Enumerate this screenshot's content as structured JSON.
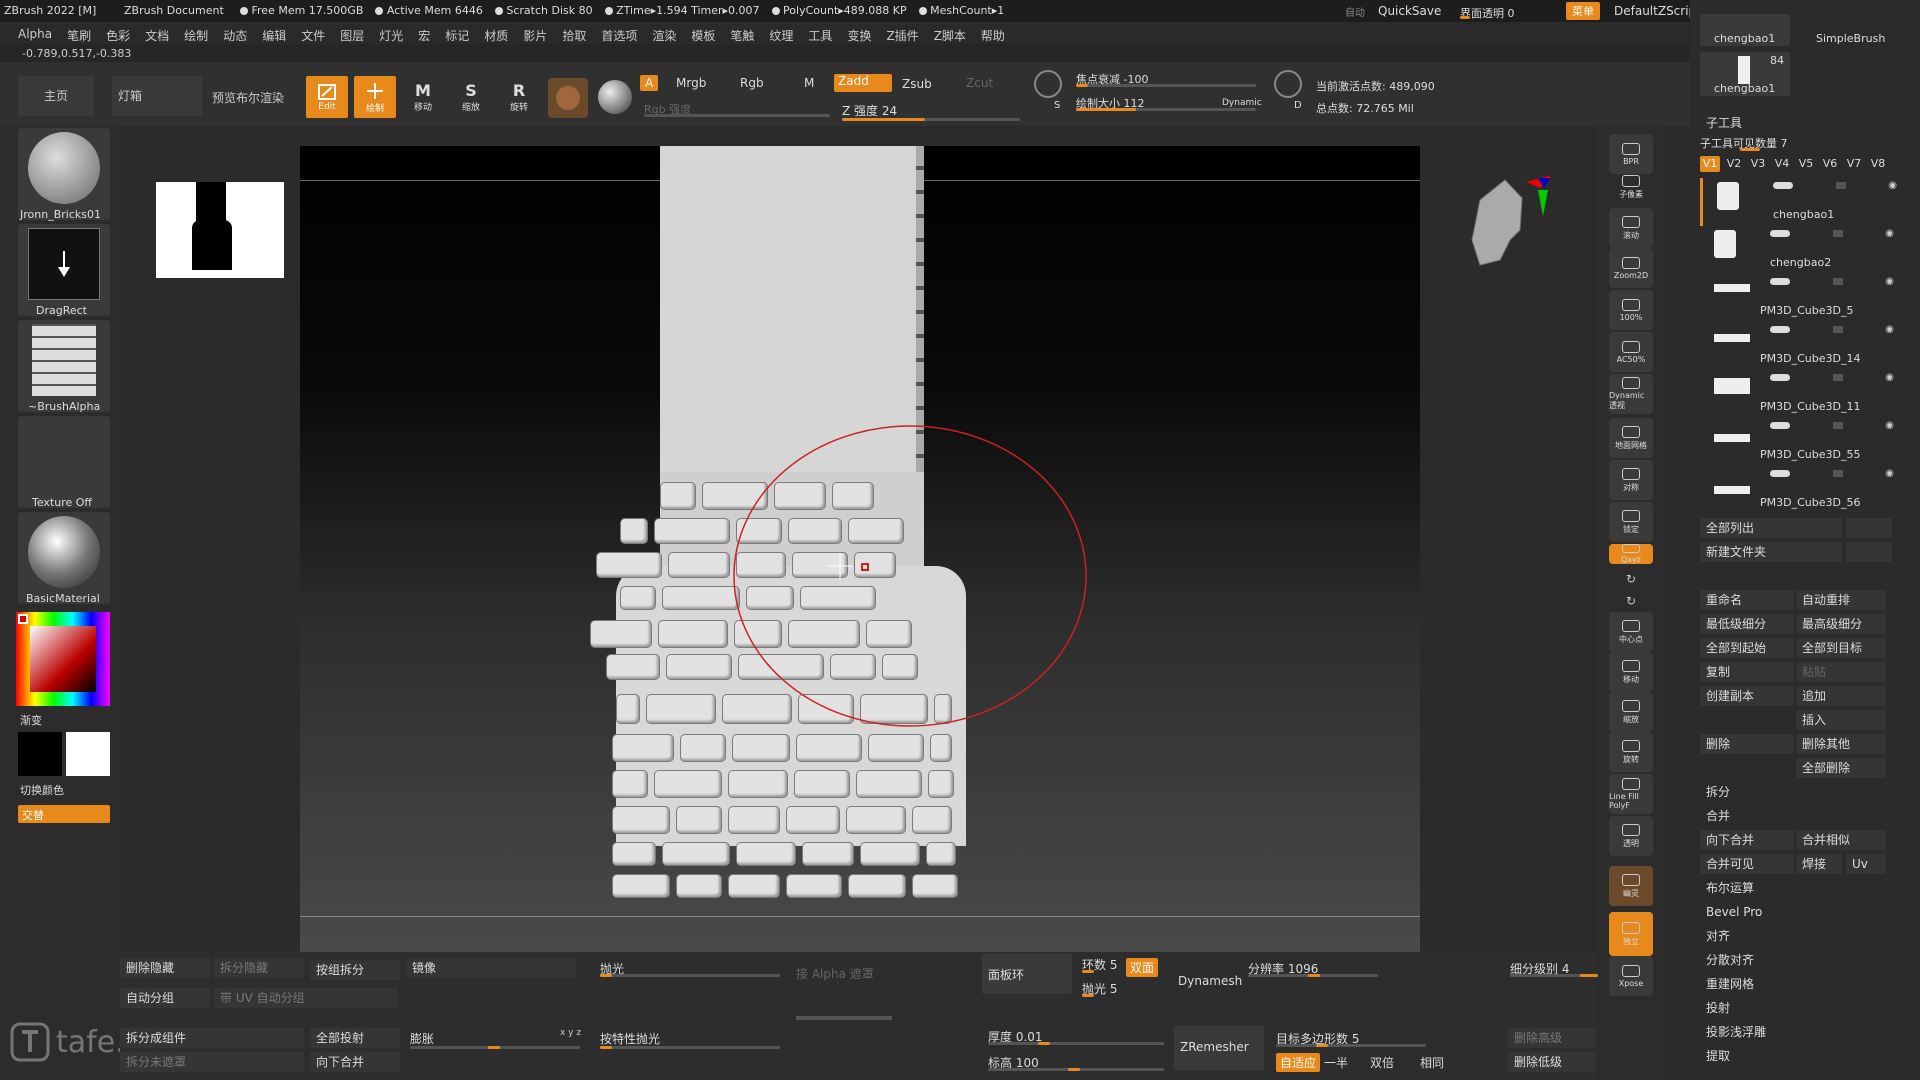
{
  "titlebar": {
    "app": "ZBrush 2022 [M]",
    "doc": "ZBrush Document",
    "stats": [
      "Free Mem 17.500GB",
      "Active Mem 6446",
      "Scratch Disk 80",
      "ZTime▸1.594 Timer▸0.007",
      "PolyCount▸489.088 KP",
      "MeshCount▸1"
    ],
    "auto": "自动",
    "quicksave": "QuickSave",
    "transparency": "界面透明 0",
    "menu": "菜单",
    "script": "DefaultZScript"
  },
  "menubar": [
    "Alpha",
    "笔刷",
    "色彩",
    "文档",
    "绘制",
    "动态",
    "编辑",
    "文件",
    "图层",
    "灯光",
    "宏",
    "标记",
    "材质",
    "影片",
    "拾取",
    "首选项",
    "渲染",
    "模板",
    "笔触",
    "纹理",
    "工具",
    "变换",
    "Z插件",
    "Z脚本",
    "帮助"
  ],
  "coords": "-0.789,0.517,-0.383",
  "shelf": {
    "home": "主页",
    "lightbox": "灯箱",
    "preview_bool": "预览布尔渲染",
    "edit": "Edit",
    "draw": "绘制",
    "move": "移动",
    "scale": "缩放",
    "rotate": "旋转",
    "a": "A",
    "mrgb": "Mrgb",
    "rgb": "Rgb",
    "m": "M",
    "zadd": "Zadd",
    "zsub": "Zsub",
    "zcut": "Zcut",
    "rgb_intensity": "Rgb 强度",
    "z_intensity": "Z 强度 24",
    "focal": "焦点衰减 -100",
    "draw_size": "绘制大小 112",
    "dynamic": "Dynamic",
    "active_points": "当前激活点数: 489,090",
    "total_points": "总点数: 72.765 Mil",
    "s": "S",
    "d": "D"
  },
  "left": {
    "brush1": "Jronn_Bricks01",
    "brush2": "DragRect",
    "alpha": "~BrushAlpha",
    "texture": "Texture Off",
    "material": "BasicMaterial",
    "gradient": "渐变",
    "switch_color": "切换颜色",
    "alternate": "交替"
  },
  "rightshelf": [
    "BPR",
    "子像素",
    "滚动",
    "Zoom2D",
    "100%",
    "AC50%",
    "Dynamic 透视",
    "地面网格",
    "对称",
    "锁定",
    "Qxyz",
    "中心点",
    "移动",
    "缩放",
    "旋转",
    "Line Fill PolyF",
    "透明",
    "幽灵",
    "独立",
    "Xpose"
  ],
  "rightpanel": {
    "top_tools": [
      "chengbao1",
      "SimpleBrush",
      "chengbao1"
    ],
    "top_count": "84",
    "subtool_title": "子工具",
    "visible_count": "子工具可见数量 7",
    "versions": [
      "V1",
      "V2",
      "V3",
      "V4",
      "V5",
      "V6",
      "V7",
      "V8"
    ],
    "subtools": [
      "chengbao1",
      "chengbao2",
      "PM3D_Cube3D_5",
      "PM3D_Cube3D_14",
      "PM3D_Cube3D_11",
      "PM3D_Cube3D_55",
      "PM3D_Cube3D_56"
    ],
    "list_all": "全部列出",
    "new_folder": "新建文件夹",
    "rename": "重命名",
    "auto_reorder": "自动重排",
    "lowest_sub": "最低级细分",
    "highest_sub": "最高级细分",
    "all_to_start": "全部到起始",
    "all_to_target": "全部到目标",
    "copy": "复制",
    "paste": "粘贴",
    "create_copy": "创建副本",
    "append": "追加",
    "insert": "插入",
    "delete": "删除",
    "delete_others": "删除其他",
    "delete_all": "全部删除",
    "split": "拆分",
    "merge": "合并",
    "merge_down": "向下合并",
    "merge_similar": "合并相似",
    "merge_visible": "合并可见",
    "weld": "焊接",
    "uv": "Uv",
    "boolean": "布尔运算",
    "bevel": "Bevel Pro",
    "align": "对齐",
    "distribute": "分散对齐",
    "remesh": "重建网格",
    "project": "投射",
    "shallow": "投影浅浮雕",
    "extract": "提取"
  },
  "bottom": {
    "del_hidden": "删除隐藏",
    "split_hidden": "拆分隐藏",
    "split_by_group": "按组拆分",
    "mirror": "镜像",
    "polish": "抛光",
    "by_alpha": "接 Alpha 遮罩",
    "auto_group": "自动分组",
    "uv_group": "带 UV 自动分组",
    "split_parts": "拆分成组件",
    "split_unmasked": "拆分未遮罩",
    "project_all": "全部投射",
    "merge_down": "向下合并",
    "inflate": "膨胀",
    "xyz": "x y z",
    "polish_features": "按特性抛光",
    "panel_loops": "面板环",
    "loops": "环数 5",
    "double": "双面",
    "polish5": "抛光 5",
    "dynamesh": "Dynamesh",
    "resolution": "分辨率 1096",
    "subdiv_level": "细分级别 4",
    "thickness": "厚度 0.01",
    "elevation": "标高 100",
    "zremesher": "ZRemesher",
    "target_poly": "目标多边形数 5",
    "adaptive": "自适应",
    "half": "一半",
    "same": "双倍",
    "same2": "相同",
    "del_higher": "删除高级",
    "del_lower": "删除低级",
    "watermark": "tafe.cc"
  },
  "colors": {
    "accent": "#e8891b",
    "panel": "#2b2b2b",
    "brush_circle": "#cc2222"
  }
}
